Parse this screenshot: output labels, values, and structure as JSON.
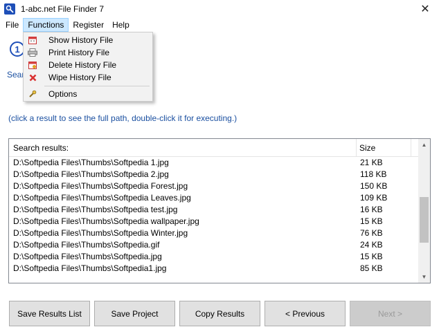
{
  "window": {
    "title": "1-abc.net File Finder 7",
    "close_glyph": "✕"
  },
  "menu": {
    "items": [
      "File",
      "Functions",
      "Register",
      "Help"
    ],
    "active": "Functions"
  },
  "functions_menu": {
    "items": [
      {
        "label": "Show History File",
        "icon": "calendar-icon"
      },
      {
        "label": "Print History File",
        "icon": "printer-icon"
      },
      {
        "label": "Delete History File",
        "icon": "calendar-delete-icon"
      },
      {
        "label": "Wipe History File",
        "icon": "red-x-icon"
      },
      {
        "label": "Options",
        "icon": "wrench-icon"
      }
    ]
  },
  "step": {
    "icon_text": "1",
    "label": "Sear"
  },
  "hint_text": "(click a result to see the full path, double-click it for executing.)",
  "results": {
    "headers": {
      "name": "Search results:",
      "size": "Size"
    },
    "rows": [
      {
        "path": "D:\\Softpedia Files\\Thumbs\\Softpedia 1.jpg",
        "size": "21 KB"
      },
      {
        "path": "D:\\Softpedia Files\\Thumbs\\Softpedia 2.jpg",
        "size": "118 KB"
      },
      {
        "path": "D:\\Softpedia Files\\Thumbs\\Softpedia Forest.jpg",
        "size": "150 KB"
      },
      {
        "path": "D:\\Softpedia Files\\Thumbs\\Softpedia Leaves.jpg",
        "size": "109 KB"
      },
      {
        "path": "D:\\Softpedia Files\\Thumbs\\Softpedia test.jpg",
        "size": "16 KB"
      },
      {
        "path": "D:\\Softpedia Files\\Thumbs\\Softpedia wallpaper.jpg",
        "size": "15 KB"
      },
      {
        "path": "D:\\Softpedia Files\\Thumbs\\Softpedia Winter.jpg",
        "size": "76 KB"
      },
      {
        "path": "D:\\Softpedia Files\\Thumbs\\Softpedia.gif",
        "size": "24 KB"
      },
      {
        "path": "D:\\Softpedia Files\\Thumbs\\Softpedia.jpg",
        "size": "15 KB"
      },
      {
        "path": "D:\\Softpedia Files\\Thumbs\\Softpedia1.jpg",
        "size": "85 KB"
      }
    ],
    "scroll": {
      "position": 0.62,
      "visible_fraction": 0.38
    }
  },
  "buttons": {
    "save_results_list": "Save Results List",
    "save_project": "Save Project",
    "copy_results": "Copy Results",
    "previous": "< Previous",
    "next": "Next >"
  },
  "colors": {
    "accent_blue": "#1a4fa0",
    "menu_highlight": "#cce8ff"
  }
}
